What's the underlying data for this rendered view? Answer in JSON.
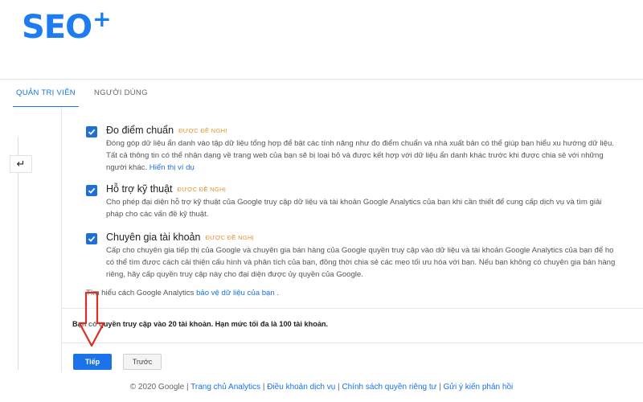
{
  "brand": {
    "logo_text": "SEO",
    "logo_plus": "+"
  },
  "tabs": [
    {
      "label": "QUẢN TRỊ VIÊN"
    },
    {
      "label": "NGƯỜI DÙNG"
    }
  ],
  "options": [
    {
      "title": "Đo điểm chuẩn",
      "badge": "ĐƯỢC ĐỀ NGHỊ",
      "checked": true,
      "desc": "Đóng góp dữ liệu ẩn danh vào tập dữ liệu tổng hợp để bật các tính năng như đo điểm chuẩn và nhà xuất bản có thể giúp bạn hiểu xu hướng dữ liệu. Tất cả thông tin có thể nhận dạng về trang web của bạn sẽ bị loại bỏ và được kết hợp với dữ liệu ẩn danh khác trước khi được chia sẻ với những người khác.",
      "link": "Hiển thị ví dụ"
    },
    {
      "title": "Hỗ trợ kỹ thuật",
      "badge": "ĐƯỢC ĐỀ NGHỊ",
      "checked": true,
      "desc": "Cho phép đại diện hỗ trợ kỹ thuật của Google truy cập dữ liệu và tài khoản Google Analytics của bạn khi cần thiết để cung cấp dịch vụ và tìm giải pháp cho các vấn đề kỹ thuật."
    },
    {
      "title": "Chuyên gia tài khoản",
      "badge": "ĐƯỢC ĐỀ NGHỊ",
      "checked": true,
      "desc": "Cấp cho chuyên gia tiếp thị của Google và chuyên gia bán hàng của Google quyền truy cập vào dữ liệu và tài khoản Google Analytics của bạn để họ có thể tìm được cách cải thiện cấu hình và phân tích của bạn, đồng thời chia sẻ các mẹo tối ưu hóa với bạn. Nếu bạn không có chuyên gia bán hàng riêng, hãy cấp quyền truy cập này cho đại diện được ủy quyền của Google."
    }
  ],
  "learn_more": {
    "prefix": "Tìm hiểu cách Google Analytics",
    "link": "bảo vệ dữ liệu của bạn",
    "suffix": "."
  },
  "account_notice": "Bạn có quyền truy cập vào 20 tài khoản. Hạn mức tối đa là 100 tài khoản.",
  "buttons": {
    "next": "Tiếp",
    "prev": "Trước"
  },
  "footer": {
    "copyright": "© 2020 Google",
    "links": [
      "Trang chủ Analytics",
      "Điều khoản dịch vụ",
      "Chính sách quyền riêng tư",
      "Gửi ý kiến phản hồi"
    ]
  },
  "colors": {
    "accent": "#1a73e8",
    "brand": "#1d7cf2",
    "badge": "#e8912d",
    "checkbox": "#1e70d6",
    "annotation": "#d93025"
  },
  "icons": {
    "back": "back-arrow-icon",
    "checkbox": "check-icon",
    "annotation": "red-down-arrow-icon"
  }
}
